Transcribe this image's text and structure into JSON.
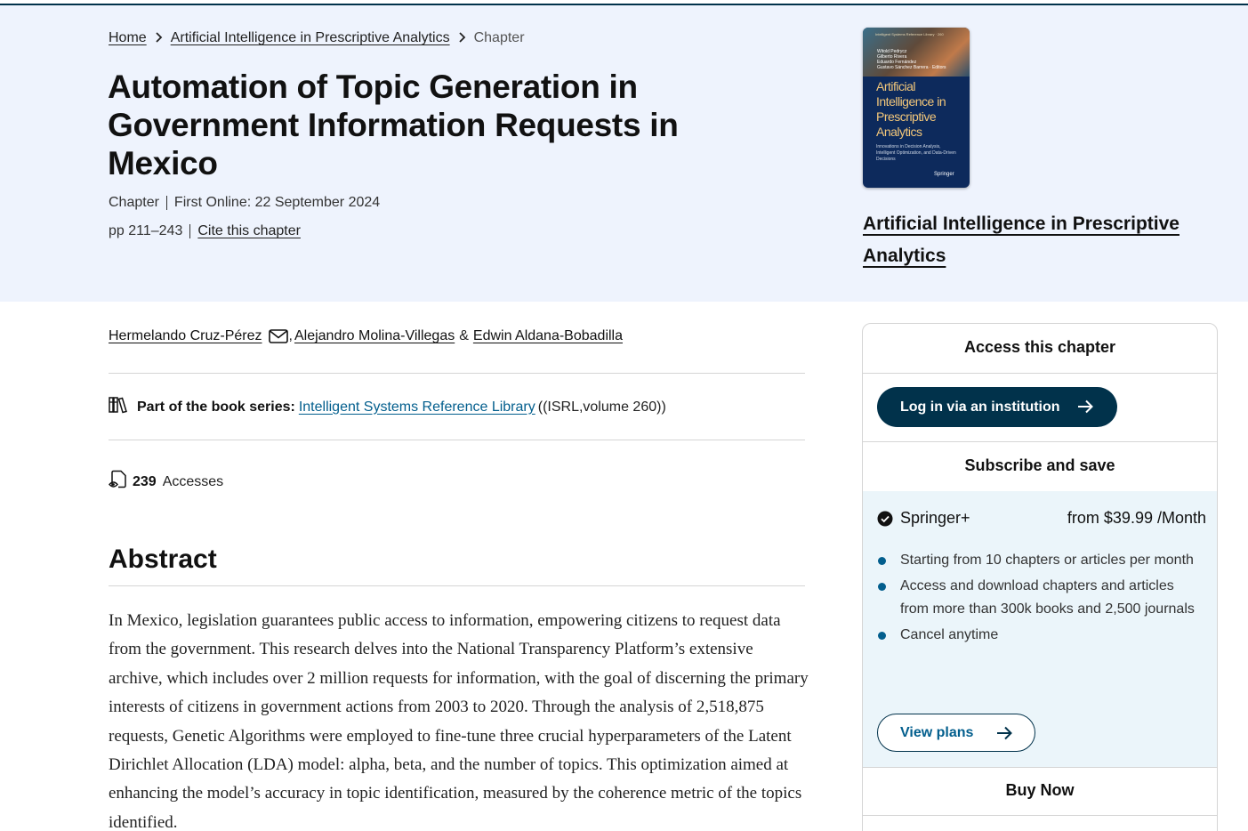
{
  "breadcrumb": {
    "home": "Home",
    "book": "Artificial Intelligence in Prescriptive Analytics",
    "current": "Chapter"
  },
  "title": "Automation of Topic Generation in Government Information Requests in Mexico",
  "meta": {
    "type": "Chapter",
    "first_online": "First Online: 22 September 2024",
    "pages": "pp 211–243",
    "cite": "Cite this chapter"
  },
  "cover": {
    "series": "Intelligent Systems Reference Library · 260",
    "editors": "Witold Pedrycz\nGilberto Rivera\nEduardo Fernández\nGustavo Sánchez Barrera · Editors",
    "title": "Artificial Intelligence in Prescriptive Analytics",
    "subtitle": "Innovations in Decision Analysis, Intelligent Optimization, and Data-Driven Decisions",
    "publisher": "Springer"
  },
  "book_link": "Artificial Intelligence in Prescriptive Analytics",
  "authors": {
    "author1": "Hermelando Cruz-Pérez",
    "author2": "Alejandro Molina-Villegas",
    "sep": ",",
    "amp": "&",
    "author3": "Edwin Aldana-Bobadilla"
  },
  "series": {
    "label": "Part of the book series:",
    "name": "Intelligent Systems Reference Library",
    "volume": "((ISRL,volume 260))"
  },
  "accesses": {
    "count": "239",
    "label": "Accesses"
  },
  "abstract": {
    "heading": "Abstract",
    "text": "In Mexico, legislation guarantees public access to information, empowering citizens to request data from the government. This research delves into the National Transparency Platform’s extensive archive, which includes over 2 million requests for information, with the goal of discerning the primary interests of citizens in government actions from 2003 to 2020. Through the analysis of 2,518,875 requests, Genetic Algorithms were employed to fine-tune three crucial hyperparameters of the Latent Dirichlet Allocation (LDA) model: alpha, beta, and the number of topics. This optimization aimed at enhancing the model’s accuracy in topic identification, measured by the coherence metric of the topics identified."
  },
  "panel": {
    "heading": "Access this chapter",
    "login_button": "Log in via an institution",
    "subscribe_heading": "Subscribe and save",
    "plan_name": "Springer+",
    "plan_price": "from $39.99 /Month",
    "benefits": [
      "Starting from 10 chapters or articles per month",
      "Access and download chapters and articles from more than 300k books and 2,500 journals",
      "Cancel anytime"
    ],
    "view_plans": "View plans",
    "buy_heading": "Buy Now"
  },
  "colors": {
    "hero_bg": "#eef3fd",
    "primary": "#01324b",
    "link": "#025e8d",
    "subscribe_bg": "#ebf5fa"
  }
}
